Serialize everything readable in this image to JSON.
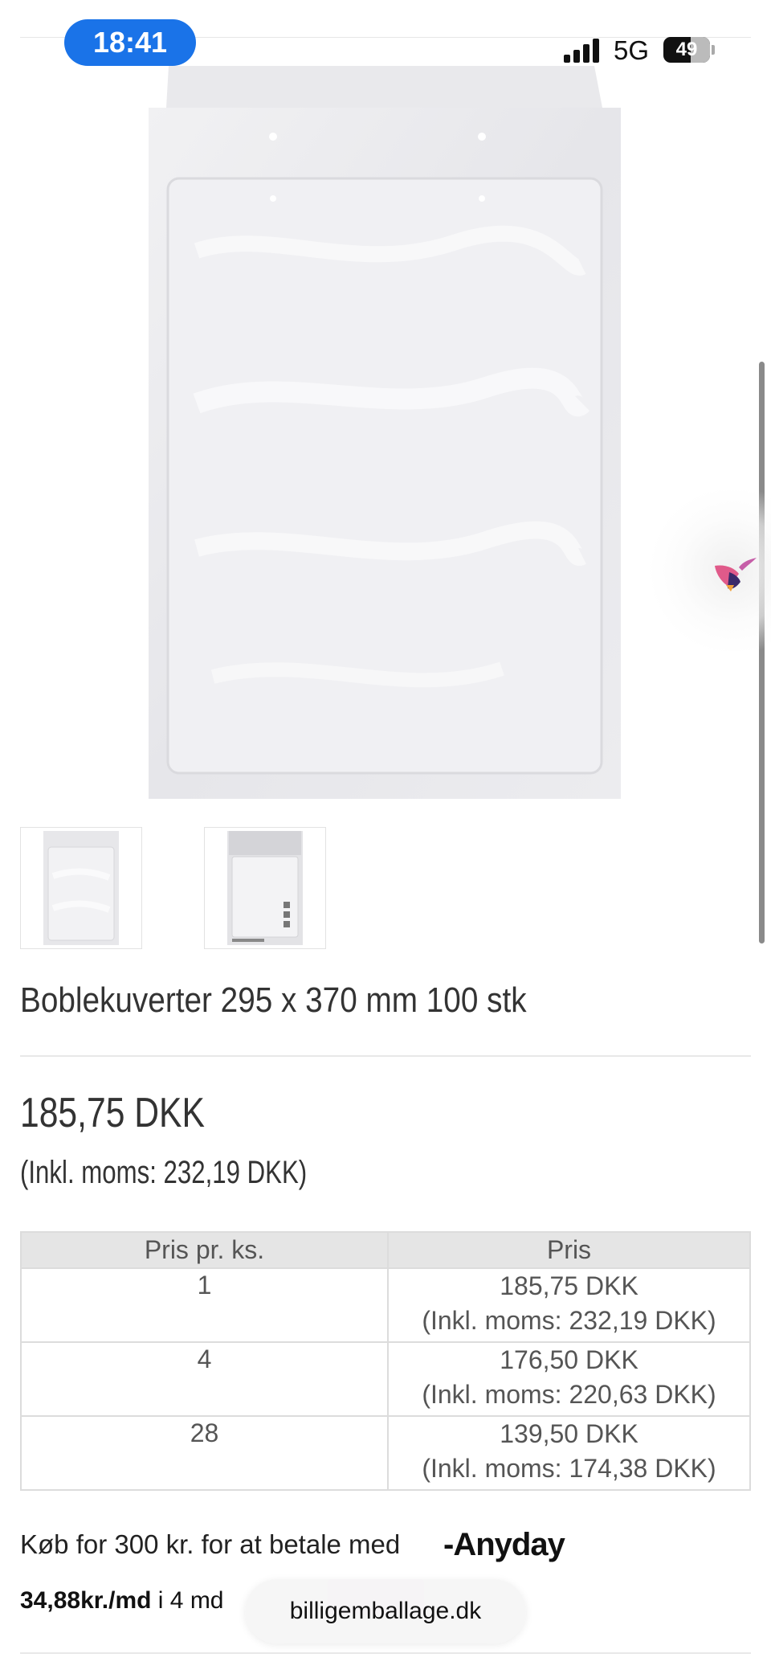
{
  "status_bar": {
    "time": "18:41",
    "network": "5G",
    "battery": "49"
  },
  "product": {
    "title": "Boblekuverter 295 x 370 mm 100 stk",
    "price": "185,75 DKK",
    "price_incl_vat": "(Inkl. moms: 232,19 DKK)"
  },
  "price_table": {
    "headers": [
      "Pris pr. ks.",
      "Pris"
    ],
    "rows": [
      {
        "qty": "1",
        "price": "185,75 DKK",
        "incl": "(Inkl. moms: 232,19 DKK)"
      },
      {
        "qty": "4",
        "price": "176,50 DKK",
        "incl": "(Inkl. moms: 220,63 DKK)"
      },
      {
        "qty": "28",
        "price": "139,50 DKK",
        "incl": "(Inkl. moms: 174,38 DKK)"
      }
    ]
  },
  "anyday": {
    "text": "Køb for 300 kr. for at betale med",
    "logo": "Anyday",
    "installment_amount": "34,88kr./md",
    "installment_rest": "i 4 md"
  },
  "browser": {
    "url": "billigemballage.dk"
  },
  "icons": {
    "assistant": "hummingbird-icon"
  },
  "colors": {
    "time_pill": "#1a73e8",
    "assistant_pink": "#e05a8a",
    "assistant_purple": "#3b2a6b",
    "assistant_orange": "#f2a23c"
  }
}
